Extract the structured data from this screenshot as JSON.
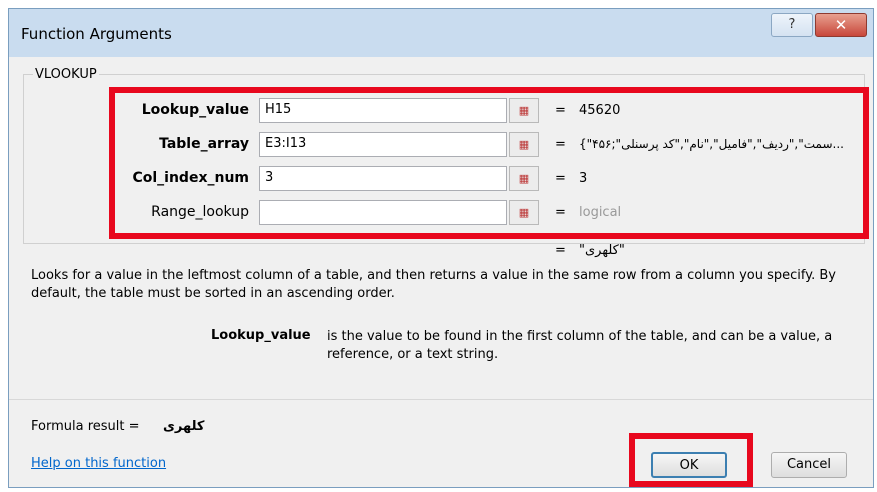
{
  "window": {
    "title": "Function Arguments",
    "help_glyph": "?",
    "close_glyph": "✕"
  },
  "function_name": "VLOOKUP",
  "arguments": [
    {
      "label": "Lookup_value",
      "value": "H15",
      "result": "45620",
      "bold": true
    },
    {
      "label": "Table_array",
      "value": "E3:I13",
      "result": "{\"۴۵۶;\"سمت\",\"ردیف\",\"فامیل\",\"نام\",\"کد پرسنلی...",
      "bold": true
    },
    {
      "label": "Col_index_num",
      "value": "3",
      "result": "3",
      "bold": true
    },
    {
      "label": "Range_lookup",
      "value": "",
      "result": "logical",
      "bold": false
    }
  ],
  "equals": "=",
  "overall_result": "\"کلهری\"",
  "description": "Looks for a value in the leftmost column of a table, and then returns a value in the same row from a column you specify. By default, the table must be sorted in an ascending order.",
  "arg_help": {
    "name": "Lookup_value",
    "text": "is the value to be found in the first column of the table, and can be a value, a reference, or a text string."
  },
  "formula_result": {
    "label": "Formula result =",
    "value": "کلهری"
  },
  "help_link": "Help on this function",
  "buttons": {
    "ok": "OK",
    "cancel": "Cancel"
  },
  "highlight_color": "#e8081e"
}
